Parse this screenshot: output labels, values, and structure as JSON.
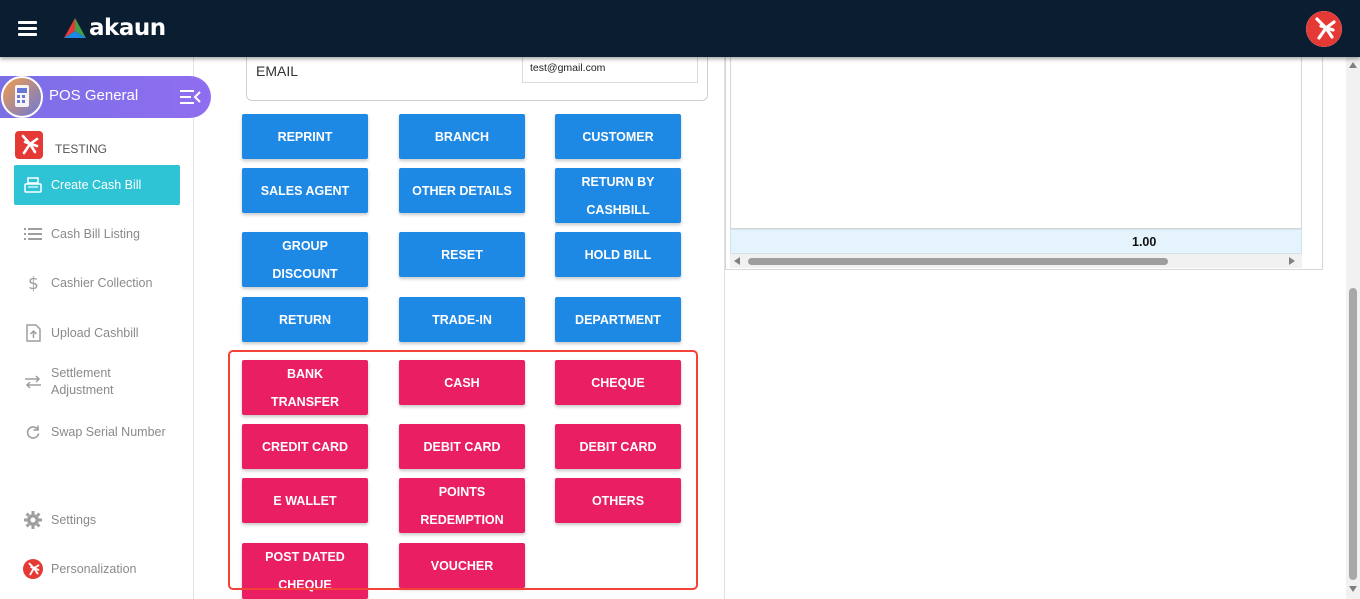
{
  "topbar": {
    "brand": "akaun"
  },
  "sidebar": {
    "app_name": "POS General",
    "company": "TESTING",
    "items": [
      {
        "label": "Create Cash Bill",
        "icon": "cash-register-icon",
        "active": true
      },
      {
        "label": "Cash Bill Listing",
        "icon": "list-icon",
        "active": false
      },
      {
        "label": "Cashier Collection",
        "icon": "dollar-icon",
        "active": false
      },
      {
        "label": "Upload Cashbill",
        "icon": "upload-file-icon",
        "active": false
      },
      {
        "label": "Settlement Adjustment",
        "icon": "swap-arrows-icon",
        "active": false
      },
      {
        "label": "Swap Serial Number",
        "icon": "refresh-icon",
        "active": false
      }
    ],
    "footer": [
      {
        "label": "Settings",
        "icon": "gear-icon"
      },
      {
        "label": "Personalization",
        "icon": "personalization-icon"
      }
    ]
  },
  "customer_form": {
    "email_label": "EMAIL",
    "email_value": "test@gmail.com"
  },
  "action_buttons": [
    {
      "label": "REPRINT"
    },
    {
      "label": "BRANCH"
    },
    {
      "label": "CUSTOMER"
    },
    {
      "label": "SALES AGENT"
    },
    {
      "label": "OTHER DETAILS"
    },
    {
      "label": "RETURN BY CASHBILL"
    },
    {
      "label": "GROUP DISCOUNT"
    },
    {
      "label": "RESET"
    },
    {
      "label": "HOLD BILL"
    },
    {
      "label": "RETURN"
    },
    {
      "label": "TRADE-IN"
    },
    {
      "label": "DEPARTMENT"
    }
  ],
  "payment_buttons": [
    {
      "label": "BANK TRANSFER"
    },
    {
      "label": "CASH"
    },
    {
      "label": "CHEQUE"
    },
    {
      "label": "CREDIT CARD"
    },
    {
      "label": "DEBIT CARD"
    },
    {
      "label": "DEBIT CARD"
    },
    {
      "label": "E WALLET"
    },
    {
      "label": "POINTS REDEMPTION"
    },
    {
      "label": "OTHERS"
    },
    {
      "label": "POST DATED CHEQUE"
    },
    {
      "label": "VOUCHER"
    }
  ],
  "bill_table": {
    "total": "1.00"
  },
  "colors": {
    "topbar": "#0b1d31",
    "action_button": "#1e88e5",
    "payment_button": "#e91e63",
    "active_nav": "#2ec4d6",
    "highlight": "#f44336"
  }
}
